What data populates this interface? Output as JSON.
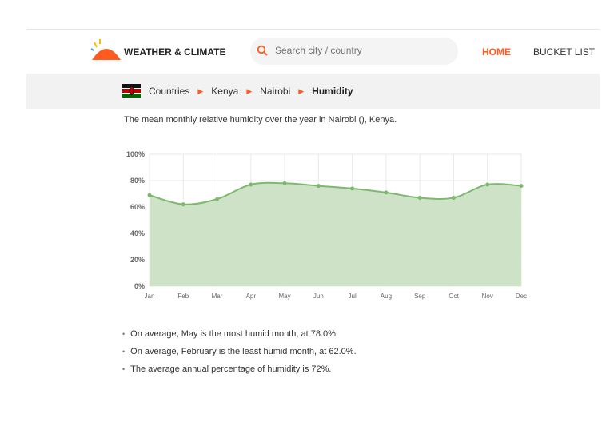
{
  "header": {
    "brand": "WEATHER & CLIMATE",
    "search_placeholder": "Search city / country",
    "nav": {
      "home": "HOME",
      "bucket_list": "BUCKET LIST"
    }
  },
  "breadcrumb": {
    "items": [
      "Countries",
      "Kenya",
      "Nairobi"
    ],
    "current": "Humidity"
  },
  "description": "The mean monthly relative humidity over the year in Nairobi (), Kenya.",
  "colors": {
    "accent": "#ff5a1f",
    "line": "#7cb86e",
    "fill": "#cbe0c4"
  },
  "chart_data": {
    "type": "area",
    "categories": [
      "Jan",
      "Feb",
      "Mar",
      "Apr",
      "May",
      "Jun",
      "Jul",
      "Aug",
      "Sep",
      "Oct",
      "Nov",
      "Dec"
    ],
    "values": [
      69,
      62,
      66,
      77,
      78,
      76,
      74,
      71,
      67,
      67,
      77,
      76
    ],
    "ylim": [
      0,
      100
    ],
    "yticks": [
      "0%",
      "20%",
      "40%",
      "60%",
      "80%",
      "100%"
    ],
    "ylabel": "",
    "xlabel": "",
    "grid": true,
    "legend": "none"
  },
  "facts": [
    "On average, May is the most humid month, at 78.0%.",
    "On average, February is the least humid month, at 62.0%.",
    "The average annual percentage of humidity is 72%."
  ]
}
